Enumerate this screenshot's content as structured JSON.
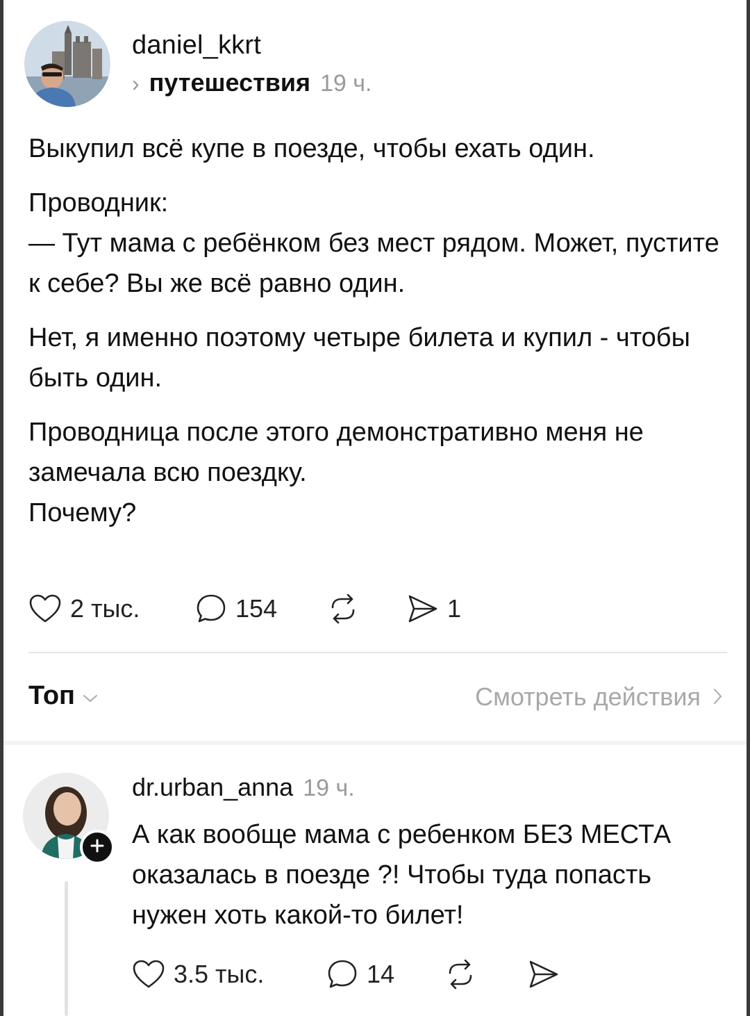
{
  "post": {
    "username": "daniel_kkrt",
    "community": "путешествия",
    "time": "19 ч.",
    "paragraphs": [
      "Выкупил всё купе в поезде, чтобы ехать один.",
      "Проводник:",
      "— Тут мама с ребёнком без мест рядом. Может, пустите к себе? Вы же всё равно один.",
      "Нет, я именно поэтому четыре билета и купил - чтобы быть один.",
      "Проводница после этого демонстративно меня не замечала всю поездку.",
      "Почему?"
    ],
    "likes": "2 тыс.",
    "comments": "154",
    "shares": "1"
  },
  "sort": {
    "label": "Топ",
    "view_actions": "Смотреть действия"
  },
  "reply": {
    "username": "dr.urban_anna",
    "time": "19 ч.",
    "text": "А как вообще мама с ребенком БЕЗ МЕСТА оказалась в поезде ?! Чтобы туда попасть нужен хоть какой-то билет!",
    "likes": "3.5 тыс.",
    "comments": "14"
  },
  "icons": {
    "like": "heart-icon",
    "comment": "comment-bubble-icon",
    "repost": "repost-icon",
    "share": "send-icon",
    "follow": "plus-icon"
  },
  "colors": {
    "text": "#111111",
    "muted": "#9a9a9a",
    "divider": "#e6e6e6"
  }
}
